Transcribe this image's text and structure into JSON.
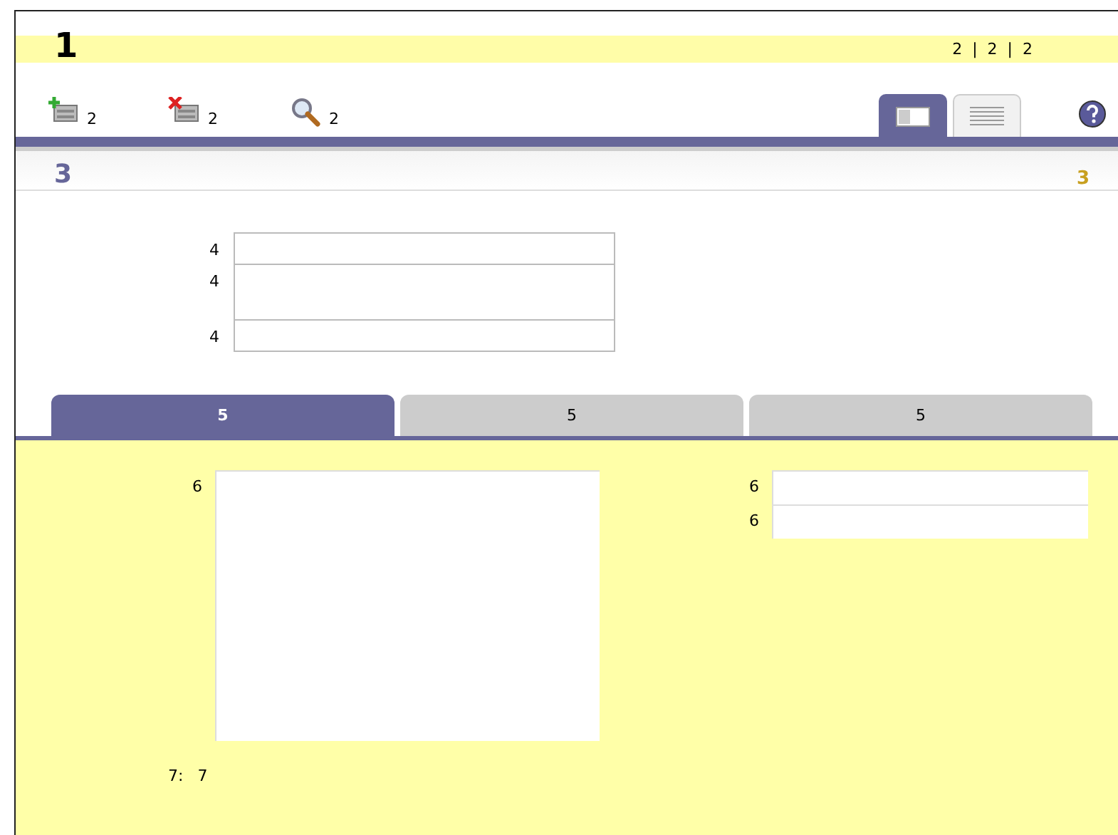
{
  "header": {
    "title": "1",
    "nav_items": [
      "2",
      "|",
      "2",
      "|",
      "2"
    ]
  },
  "toolbar": {
    "actions": [
      {
        "kind": "add",
        "label": "2"
      },
      {
        "kind": "delete",
        "label": "2"
      },
      {
        "kind": "search",
        "label": "2"
      }
    ],
    "views": [
      {
        "kind": "form",
        "selected": true
      },
      {
        "kind": "list",
        "selected": false
      }
    ]
  },
  "section": {
    "title": "3",
    "note": "3"
  },
  "fields": [
    {
      "label": "4",
      "kind": "line"
    },
    {
      "label": "4",
      "kind": "tall"
    },
    {
      "label": "4",
      "kind": "line"
    }
  ],
  "tabs": [
    {
      "label": "5",
      "selected": true
    },
    {
      "label": "5",
      "selected": false
    },
    {
      "label": "5",
      "selected": false
    }
  ],
  "panel": {
    "left_fields": [
      {
        "label": "6",
        "kind": "area"
      }
    ],
    "right_fields": [
      {
        "label": "6",
        "kind": "line"
      },
      {
        "label": "6",
        "kind": "line"
      }
    ],
    "footer": {
      "label": "7:",
      "value": "7"
    }
  }
}
